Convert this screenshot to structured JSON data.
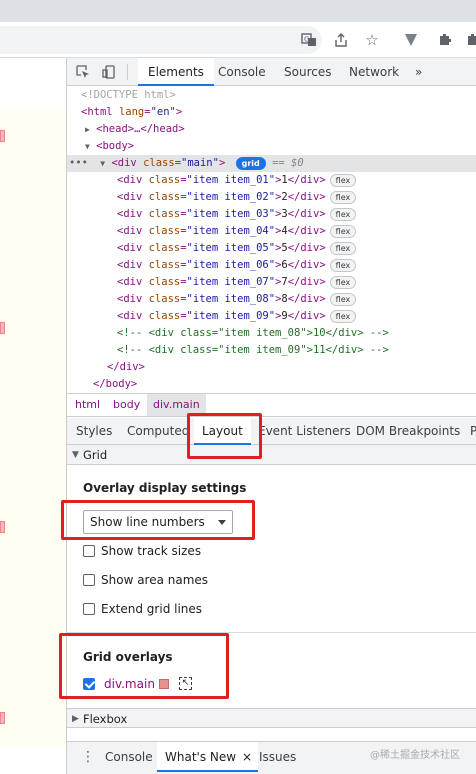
{
  "browser": {
    "icons": [
      "translate-icon",
      "share-icon",
      "bookmark-star-icon",
      "extension-v-icon",
      "puzzle-icon"
    ]
  },
  "devtools": {
    "tabs": [
      "Elements",
      "Console",
      "Sources",
      "Network"
    ],
    "more": "»"
  },
  "dom": {
    "doctype": "<!DOCTYPE html>",
    "html_open": "html",
    "html_attr": "lang",
    "html_val": "\"en\"",
    "head_text": "<head>…</head>",
    "body_text": "<body>",
    "main_tag": "div",
    "main_attr": "class",
    "main_val": "\"main\"",
    "grid_badge": "grid",
    "eq0": "== $0",
    "ellipsis": "•••",
    "items": [
      {
        "cls": "\"item item_01\"",
        "text": "1",
        "badge": "flex"
      },
      {
        "cls": "\"item item_02\"",
        "text": "2",
        "badge": "flex"
      },
      {
        "cls": "\"item item_03\"",
        "text": "3",
        "badge": "flex"
      },
      {
        "cls": "\"item item_04\"",
        "text": "4",
        "badge": "flex"
      },
      {
        "cls": "\"item item_05\"",
        "text": "5",
        "badge": "flex"
      },
      {
        "cls": "\"item item_06\"",
        "text": "6",
        "badge": "flex"
      },
      {
        "cls": "\"item item_07\"",
        "text": "7",
        "badge": "flex"
      },
      {
        "cls": "\"item item_08\"",
        "text": "8",
        "badge": "flex"
      },
      {
        "cls": "\"item item_09\"",
        "text": "9",
        "badge": "flex"
      }
    ],
    "comments": [
      "<!-- <div class=\"item item_08\">10</div> -->",
      "<!-- <div class=\"item item_09\">11</div> -->"
    ],
    "close_div": "</div>",
    "close_body": "</body>"
  },
  "breadcrumb": [
    "html",
    "body",
    "div.main"
  ],
  "sidebar_tabs": [
    "Styles",
    "Computed",
    "Layout",
    "Event Listeners",
    "DOM Breakpoints",
    "P"
  ],
  "grid_section": {
    "title": "Grid",
    "overlay_heading": "Overlay display settings",
    "select_value": "Show line numbers",
    "checkboxes": [
      {
        "label": "Show track sizes",
        "checked": false
      },
      {
        "label": "Show area names",
        "checked": false
      },
      {
        "label": "Extend grid lines",
        "checked": false
      }
    ],
    "overlays_heading": "Grid overlays",
    "overlay_item": {
      "label": "div.main",
      "checked": true,
      "color": "#e8908e"
    }
  },
  "flexbox_section": {
    "title": "Flexbox"
  },
  "drawer": {
    "tabs": [
      "Console",
      "What's New",
      "Issues"
    ],
    "close": "×",
    "menu": "⋮"
  },
  "watermark": "@稀土掘金技术社区"
}
